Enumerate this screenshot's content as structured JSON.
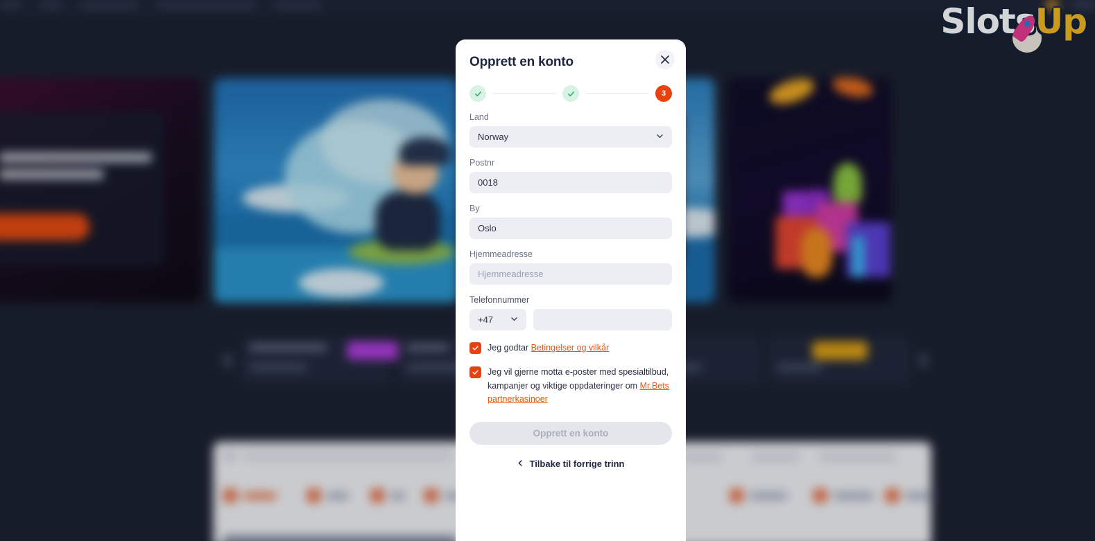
{
  "site": {
    "logo_slots": "Slots",
    "logo_up": "Up",
    "logo_name": "SlotsUp"
  },
  "background": {
    "nav_items": [
      "",
      "",
      "",
      "",
      ""
    ],
    "banners": [
      {
        "id": "banner-a",
        "cta": ""
      },
      {
        "id": "banner-b",
        "cta": ""
      },
      {
        "id": "banner-c",
        "cta": ""
      },
      {
        "id": "banner-d",
        "cta": ""
      }
    ],
    "carousel_items": [
      "",
      "",
      "",
      ""
    ]
  },
  "modal": {
    "title": "Opprett en konto",
    "close_label": "×",
    "stepper": {
      "steps": [
        {
          "state": "done",
          "label": "✓"
        },
        {
          "state": "done",
          "label": "✓"
        },
        {
          "state": "current",
          "label": "3"
        }
      ],
      "current_step": 3,
      "total_steps": 3
    },
    "fields": {
      "country": {
        "label": "Land",
        "value": "Norway",
        "icon": "chevron-down-icon"
      },
      "postal_code": {
        "label": "Postnr",
        "value": "0018",
        "placeholder": "Postnr"
      },
      "city": {
        "label": "By",
        "value": "Oslo",
        "placeholder": "By"
      },
      "address": {
        "label": "Hjemmeadresse",
        "value": "",
        "placeholder": "Hjemmeadresse"
      },
      "phone": {
        "label": "Telefonnummer",
        "dial_code": "+47",
        "number": "",
        "placeholder": ""
      }
    },
    "terms_checkbox": {
      "checked": true,
      "text": "Jeg godtar",
      "link_text": "Betingelser og vilkår"
    },
    "marketing_checkbox": {
      "checked": true,
      "text": "Jeg vil gjerne motta e-poster med spesialtilbud, kampanjer og viktige oppdateringer om",
      "link_text": "Mr.Bets partnerkasinoer"
    },
    "submit_label": "Opprett en konto",
    "submit_disabled": true,
    "back_label": "Tilbake til forrige trinn",
    "back_icon": "chevron-left-icon"
  },
  "colors": {
    "accent_orange": "#e8430f",
    "link_orange": "#e8560f",
    "step_done_bg": "#d8f2e4",
    "step_done_check": "#2fae77",
    "input_bg": "#eceef4",
    "page_bg": "#1a1f2e",
    "logo_yellow": "#f5b91f"
  }
}
